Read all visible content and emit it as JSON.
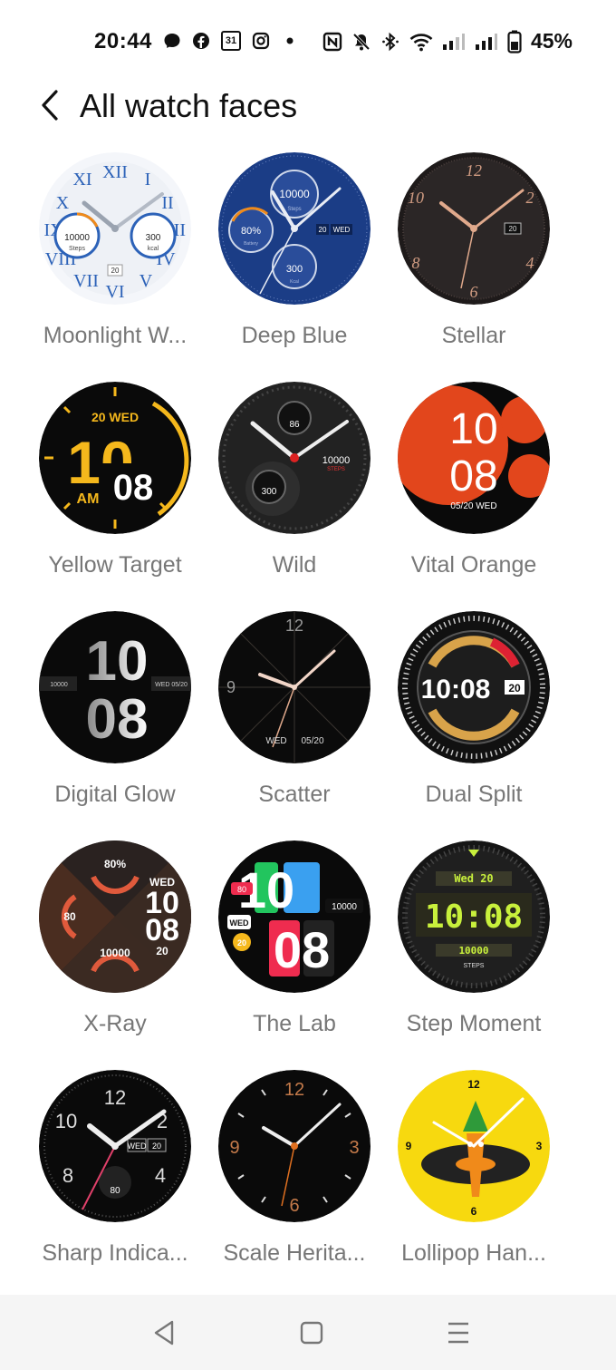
{
  "status_bar": {
    "time": "20:44",
    "battery_percent": "45%",
    "left_icons": [
      "messenger-icon",
      "facebook-icon",
      "calendar-icon",
      "instagram-icon",
      "dot-icon"
    ],
    "right_icons": [
      "nfc-icon",
      "mute-icon",
      "bluetooth-icon",
      "wifi-icon",
      "signal-icon",
      "signal-icon",
      "battery-icon"
    ],
    "calendar_day": "31"
  },
  "header": {
    "title": "All watch faces"
  },
  "faces": [
    {
      "name": "Moonlight W...",
      "texts": [
        "10000",
        "Steps",
        "300",
        "kcal",
        "20"
      ]
    },
    {
      "name": "Deep Blue",
      "texts": [
        "10000",
        "Steps",
        "80%",
        "Battery",
        "20",
        "WED",
        "300",
        "Kcal"
      ]
    },
    {
      "name": "Stellar",
      "texts": [
        "12",
        "2",
        "4",
        "6",
        "8",
        "10",
        "20"
      ]
    },
    {
      "name": "Yellow Target",
      "texts": [
        "20 WED",
        "10",
        "08",
        "AM"
      ]
    },
    {
      "name": "Wild",
      "texts": [
        "86",
        "10000",
        "STEPS",
        "300"
      ]
    },
    {
      "name": "Vital Orange",
      "texts": [
        "10",
        "08",
        "05/20 WED"
      ]
    },
    {
      "name": "Digital Glow",
      "texts": [
        "10",
        "08",
        "10000",
        "WED 05/20"
      ]
    },
    {
      "name": "Scatter",
      "texts": [
        "12",
        "9",
        "WED",
        "05/20"
      ]
    },
    {
      "name": "Dual Split",
      "texts": [
        "10:08",
        "20"
      ]
    },
    {
      "name": "X-Ray",
      "texts": [
        "80%",
        "80",
        "WED",
        "10",
        "08",
        "20",
        "10000"
      ]
    },
    {
      "name": "The Lab",
      "texts": [
        "10",
        "08",
        "80",
        "10000",
        "WED",
        "20"
      ]
    },
    {
      "name": "Step Moment",
      "texts": [
        "Wed 20",
        "10:08",
        "10000",
        "STEPS"
      ]
    },
    {
      "name": "Sharp Indica...",
      "texts": [
        "12",
        "2",
        "4",
        "8",
        "10",
        "WED",
        "20",
        "80"
      ]
    },
    {
      "name": "Scale Herita...",
      "texts": [
        "12",
        "3",
        "6",
        "9"
      ]
    },
    {
      "name": "Lollipop Han...",
      "texts": [
        "12",
        "3",
        "6",
        "9"
      ]
    }
  ],
  "nav_bar": {
    "icons": [
      "back-triangle-icon",
      "home-square-icon",
      "menu-lines-icon"
    ]
  },
  "colors": {
    "accent_yellow": "#f5b81c",
    "orange": "#e2461c",
    "blue": "#1b3d86",
    "label_gray": "#777777"
  }
}
